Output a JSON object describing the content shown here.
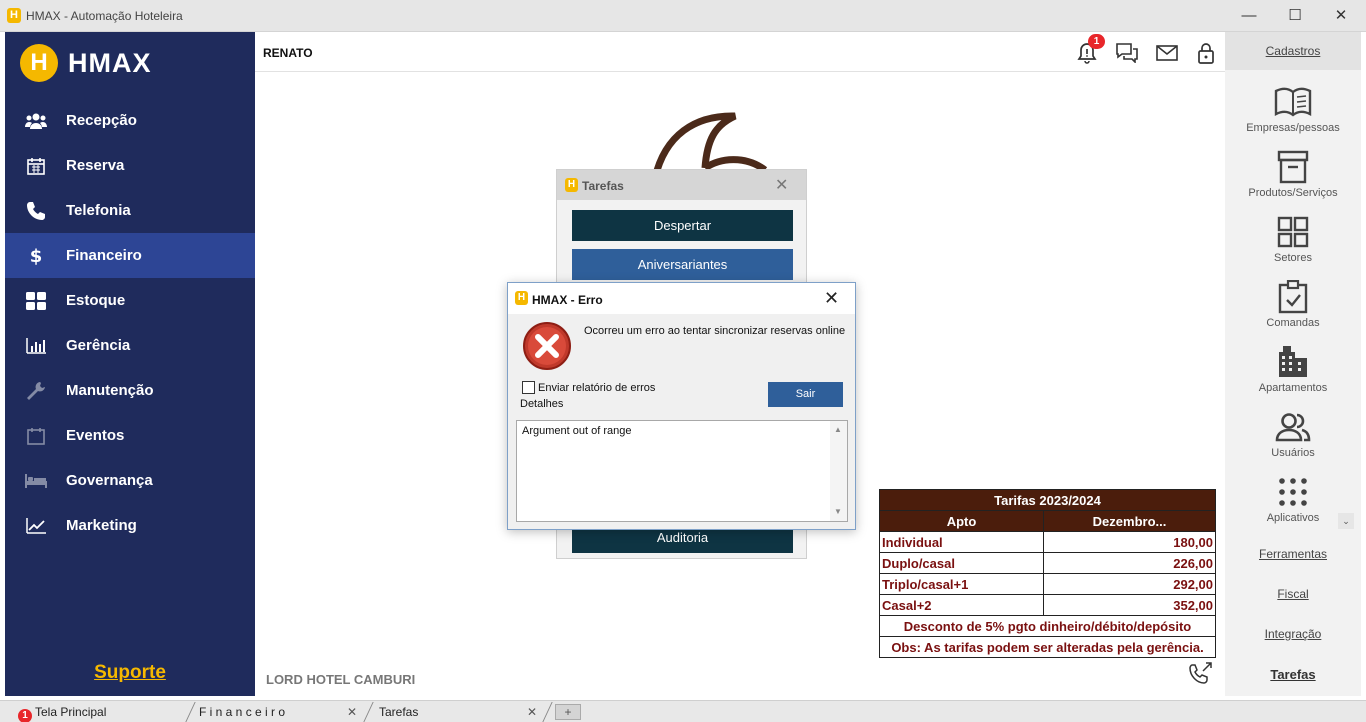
{
  "window": {
    "title": "HMAX - Automação Hoteleira",
    "app_icon_letter": "H",
    "controls": {
      "minimize": "—",
      "maximize": "☐",
      "close": "✕"
    }
  },
  "sidebar": {
    "logo_letter": "H",
    "logo_text": "HMAX",
    "items": [
      {
        "label": "Recepção",
        "icon": "people-icon"
      },
      {
        "label": "Reserva",
        "icon": "calendar-icon"
      },
      {
        "label": "Telefonia",
        "icon": "phone-icon"
      },
      {
        "label": "Financeiro",
        "icon": "dollar-icon",
        "active": true
      },
      {
        "label": "Estoque",
        "icon": "grid-icon"
      },
      {
        "label": "Gerência",
        "icon": "bar-chart-icon"
      },
      {
        "label": "Manutenção",
        "icon": "wrench-icon"
      },
      {
        "label": "Eventos",
        "icon": "calendar-outline-icon"
      },
      {
        "label": "Governança",
        "icon": "bed-icon"
      },
      {
        "label": "Marketing",
        "icon": "trend-icon"
      }
    ],
    "support": "Suporte"
  },
  "header": {
    "user": "RENATO",
    "notification_count": "1"
  },
  "main": {
    "hotel_name": "LORD HOTEL CAMBURI"
  },
  "right_panel": {
    "title": "Cadastros",
    "items": [
      {
        "label": "Empresas/pessoas",
        "icon": "book-icon"
      },
      {
        "label": "Produtos/Serviços",
        "icon": "archive-icon"
      },
      {
        "label": "Setores",
        "icon": "grid-icon"
      },
      {
        "label": "Comandas",
        "icon": "clipboard-check-icon"
      },
      {
        "label": "Apartamentos",
        "icon": "building-icon"
      },
      {
        "label": "Usuários",
        "icon": "users-icon"
      },
      {
        "label": "Aplicativos",
        "icon": "apps-icon"
      }
    ],
    "links": [
      "Ferramentas",
      "Fiscal",
      "Integração",
      "Tarefas"
    ]
  },
  "tarefas_window": {
    "title": "Tarefas",
    "buttons": [
      "Despertar",
      "Aniversariantes",
      "Auditoria"
    ]
  },
  "error_dialog": {
    "title": "HMAX - Erro",
    "message": "Ocorreu um erro ao tentar sincronizar reservas online",
    "checkbox_label": "Enviar relatório de erros",
    "details_label": "Detalhes",
    "button": "Sair",
    "details_text": "Argument out of range"
  },
  "rates": {
    "title": "Tarifas 2023/2024",
    "col_apto": "Apto",
    "col_month": "Dezembro...",
    "rows": [
      {
        "apto": "Individual",
        "value": "180,00"
      },
      {
        "apto": "Duplo/casal",
        "value": "226,00"
      },
      {
        "apto": "Triplo/casal+1",
        "value": "292,00"
      },
      {
        "apto": "Casal+2",
        "value": "352,00"
      }
    ],
    "discount": "Desconto de 5% pgto dinheiro/débito/depósito",
    "note": "Obs: As tarifas podem ser alteradas pela gerência."
  },
  "tabs": [
    {
      "label": "Tela Principal",
      "badge": "1"
    },
    {
      "label": "F i n a n c e i r o"
    },
    {
      "label": "Tarefas"
    }
  ],
  "tab_add": "+",
  "colors": {
    "sidebar_bg": "#1f2b5c",
    "sidebar_active": "#2d4595",
    "accent_yellow": "#f5b800",
    "button_dark": "#0e3443",
    "button_blue": "#2f5f9a",
    "rates_header": "#4b1d0c",
    "rates_text": "#7a1010"
  }
}
